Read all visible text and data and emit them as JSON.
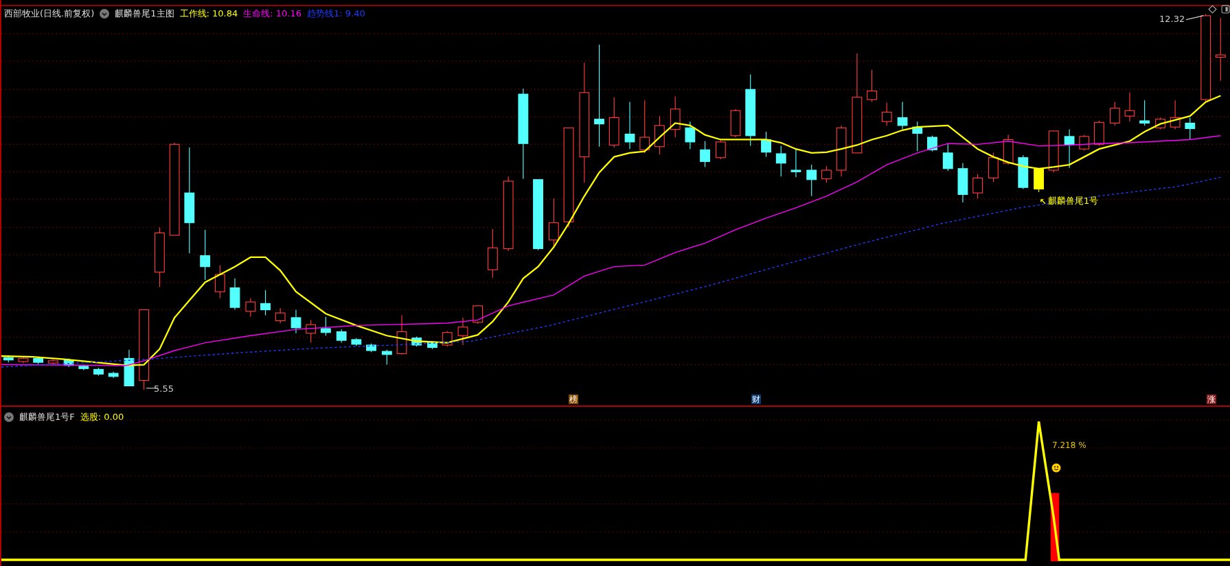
{
  "main": {
    "title": "西部牧业(日线.前复权)",
    "indicator": "麒麟兽尾1主图",
    "legend": [
      {
        "text": "工作线: 10.84",
        "color": "#ffff00"
      },
      {
        "text": "生命线: 10.16",
        "color": "#ff00ff"
      },
      {
        "text": "趋势线1: 9.40",
        "color": "#1e3cff"
      }
    ],
    "high_label": "12.32",
    "low_label": "5.55",
    "signal_label": "麒麟兽尾1号",
    "badges": [
      {
        "text": "榜",
        "color": "#8b4a00"
      },
      {
        "text": "财",
        "color": "#0a3a78"
      },
      {
        "text": "涨",
        "color": "#8b1a1a"
      }
    ]
  },
  "sub": {
    "indicator": "麒麟兽尾1号F",
    "legend": [
      {
        "text": "选股: 0.00",
        "color": "#ffff00"
      }
    ],
    "percent_label": "7.218 %"
  }
}
